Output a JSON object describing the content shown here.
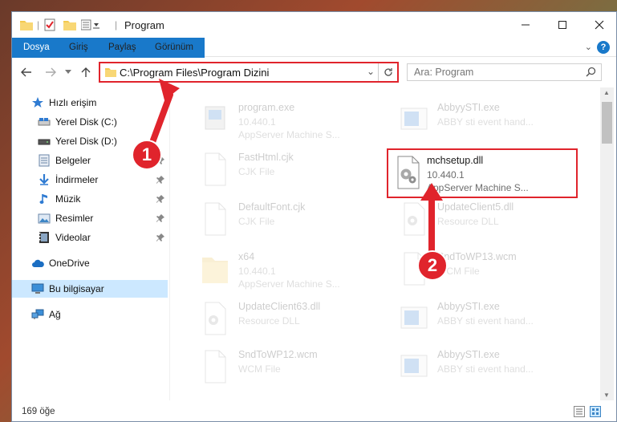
{
  "window": {
    "title": "Program"
  },
  "ribbon": {
    "tabs": [
      "Dosya",
      "Giriş",
      "Paylaş",
      "Görünüm"
    ]
  },
  "address": {
    "path": "C:\\Program Files\\Program Dizini"
  },
  "search": {
    "placeholder": "Ara: Program"
  },
  "sidebar": {
    "items": [
      {
        "label": "Hızlı erişim",
        "icon": "star-icon"
      },
      {
        "label": "Yerel Disk (C:)",
        "icon": "drive-icon"
      },
      {
        "label": "Yerel Disk (D:)",
        "icon": "drive-icon"
      },
      {
        "label": "Belgeler",
        "icon": "documents-icon"
      },
      {
        "label": "İndirmeler",
        "icon": "download-icon"
      },
      {
        "label": "Müzik",
        "icon": "music-icon"
      },
      {
        "label": "Resimler",
        "icon": "pictures-icon"
      },
      {
        "label": "Videolar",
        "icon": "video-icon"
      },
      {
        "label": "OneDrive",
        "icon": "cloud-icon"
      },
      {
        "label": "Bu bilgisayar",
        "icon": "computer-icon"
      },
      {
        "label": "Ağ",
        "icon": "network-icon"
      }
    ]
  },
  "files": {
    "left": [
      {
        "name": "program.exe",
        "line1": "10.440.1",
        "line2": "AppServer Machine S..."
      },
      {
        "name": "FastHtml.cjk",
        "line1": "CJK File",
        "line2": ""
      },
      {
        "name": "DefaultFont.cjk",
        "line1": "CJK File",
        "line2": ""
      },
      {
        "name": "x64",
        "line1": "10.440.1",
        "line2": "AppServer Machine S..."
      },
      {
        "name": "UpdateClient63.dll",
        "line1": "Resource DLL",
        "line2": ""
      },
      {
        "name": "SndToWP12.wcm",
        "line1": "WCM File",
        "line2": ""
      }
    ],
    "right": [
      {
        "name": "AbbyySTI.exe",
        "line1": "ABBY sti event hand...",
        "line2": ""
      },
      {
        "name": "mchsetup.dll",
        "line1": "10.440.1",
        "line2": "AppServer Machine S..."
      },
      {
        "name": "UpdateClient5.dll",
        "line1": "Resource DLL",
        "line2": ""
      },
      {
        "name": "SndToWP13.wcm",
        "line1": "WCM File",
        "line2": ""
      },
      {
        "name": "AbbyySTI.exe",
        "line1": "ABBY sti event hand...",
        "line2": ""
      },
      {
        "name": "AbbyySTI.exe",
        "line1": "ABBY sti event hand...",
        "line2": ""
      }
    ]
  },
  "status": {
    "count": "169 öğe"
  },
  "callouts": [
    "1",
    "2"
  ],
  "colors": {
    "accent": "#1979ca",
    "highlight": "#e0242c",
    "selection": "#cce8ff"
  }
}
